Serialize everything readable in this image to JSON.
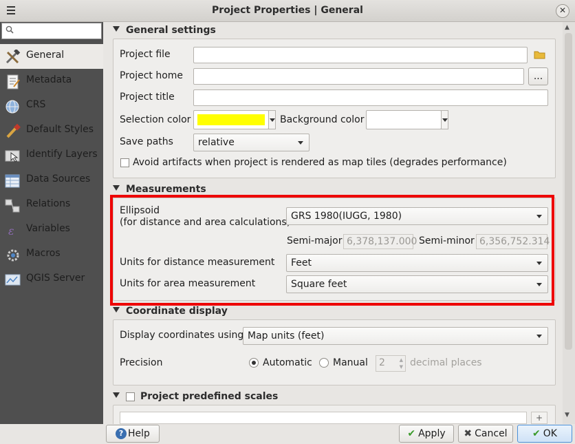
{
  "window": {
    "title": "Project Properties | General"
  },
  "sidebar": {
    "search_placeholder": "",
    "items": [
      {
        "label": "General",
        "icon": "tools-icon",
        "active": true
      },
      {
        "label": "Metadata",
        "icon": "document-icon"
      },
      {
        "label": "CRS",
        "icon": "globe-icon"
      },
      {
        "label": "Default Styles",
        "icon": "paintbrush-icon"
      },
      {
        "label": "Identify Layers",
        "icon": "identify-icon"
      },
      {
        "label": "Data Sources",
        "icon": "table-icon"
      },
      {
        "label": "Relations",
        "icon": "relations-icon"
      },
      {
        "label": "Variables",
        "icon": "variables-icon"
      },
      {
        "label": "Macros",
        "icon": "macros-icon"
      },
      {
        "label": "QGIS Server",
        "icon": "server-icon"
      }
    ]
  },
  "general": {
    "header": "General settings",
    "project_file_label": "Project file",
    "project_file_value": "",
    "project_home_label": "Project home",
    "project_home_value": "",
    "browse_label": "...",
    "project_title_label": "Project title",
    "project_title_value": "",
    "selection_color_label": "Selection color",
    "selection_color": "#ffff00",
    "background_color_label": "Background color",
    "background_color": "#ffffff",
    "save_paths_label": "Save paths",
    "save_paths_value": "relative",
    "avoid_artifacts_label": "Avoid artifacts when project is rendered as map tiles (degrades performance)",
    "avoid_artifacts_checked": false
  },
  "measurements": {
    "header": "Measurements",
    "ellipsoid_label": "Ellipsoid",
    "ellipsoid_sublabel": "(for distance and area calculations)",
    "ellipsoid_value": "GRS 1980(IUGG, 1980)",
    "semi_major_label": "Semi-major",
    "semi_major_value": "6,378,137.000",
    "semi_minor_label": "Semi-minor",
    "semi_minor_value": "6,356,752.314",
    "distance_units_label": "Units for distance measurement",
    "distance_units_value": "Feet",
    "area_units_label": "Units for area measurement",
    "area_units_value": "Square feet",
    "highlight_color": "#ee0000"
  },
  "coordinates": {
    "header": "Coordinate display",
    "display_label": "Display coordinates using",
    "display_value": "Map units (feet)",
    "precision_label": "Precision",
    "automatic_label": "Automatic",
    "automatic_selected": true,
    "manual_label": "Manual",
    "manual_value": "2",
    "decimal_places_label": "decimal places"
  },
  "scales": {
    "header": "Project predefined scales",
    "checked": false
  },
  "footer": {
    "help_label": "Help",
    "apply_label": "Apply",
    "cancel_label": "Cancel",
    "ok_label": "OK"
  }
}
